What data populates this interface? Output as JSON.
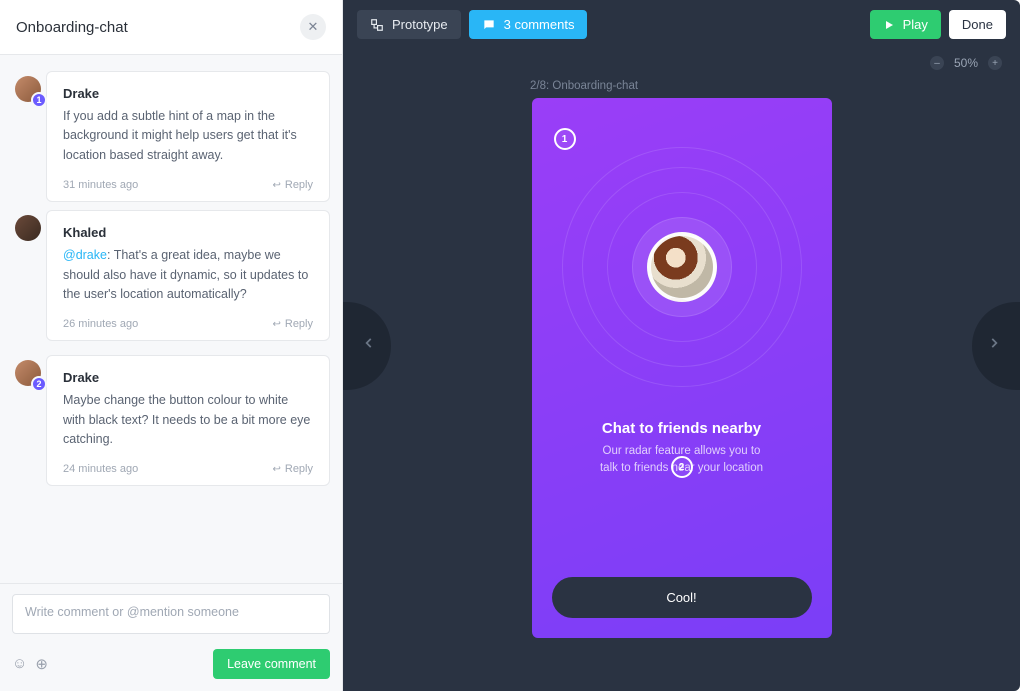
{
  "header": {
    "title": "Onboarding-chat"
  },
  "comments": [
    {
      "pin": "1",
      "author": "Drake",
      "body": "If you add a subtle hint of a map in the background it might help users get that it's location based straight away.",
      "time": "31 minutes ago",
      "reply_label": "Reply",
      "replies": [
        {
          "author": "Khaled",
          "mention": "@drake",
          "body": ": That's a great idea, maybe we should also have it dynamic, so it updates to the user's location automatically?",
          "time": "26 minutes ago",
          "reply_label": "Reply"
        }
      ]
    },
    {
      "pin": "2",
      "author": "Drake",
      "body": "Maybe change the button colour to white with black text? It needs to be a bit more eye catching.",
      "time": "24 minutes ago",
      "reply_label": "Reply",
      "replies": []
    }
  ],
  "composer": {
    "placeholder": "Write comment or @mention someone",
    "submit_label": "Leave comment"
  },
  "toolbar": {
    "prototype_label": "Prototype",
    "comments_label": "3 comments",
    "play_label": "Play",
    "done_label": "Done"
  },
  "zoom": {
    "value": "50%"
  },
  "canvas": {
    "label": "2/8: Onboarding-chat",
    "mock": {
      "pin1": "1",
      "pin2": "2",
      "title": "Chat to friends nearby",
      "subtitle_line1": "Our radar feature allows you to",
      "subtitle_line2": "talk to friends near your location",
      "button": "Cool!"
    }
  }
}
